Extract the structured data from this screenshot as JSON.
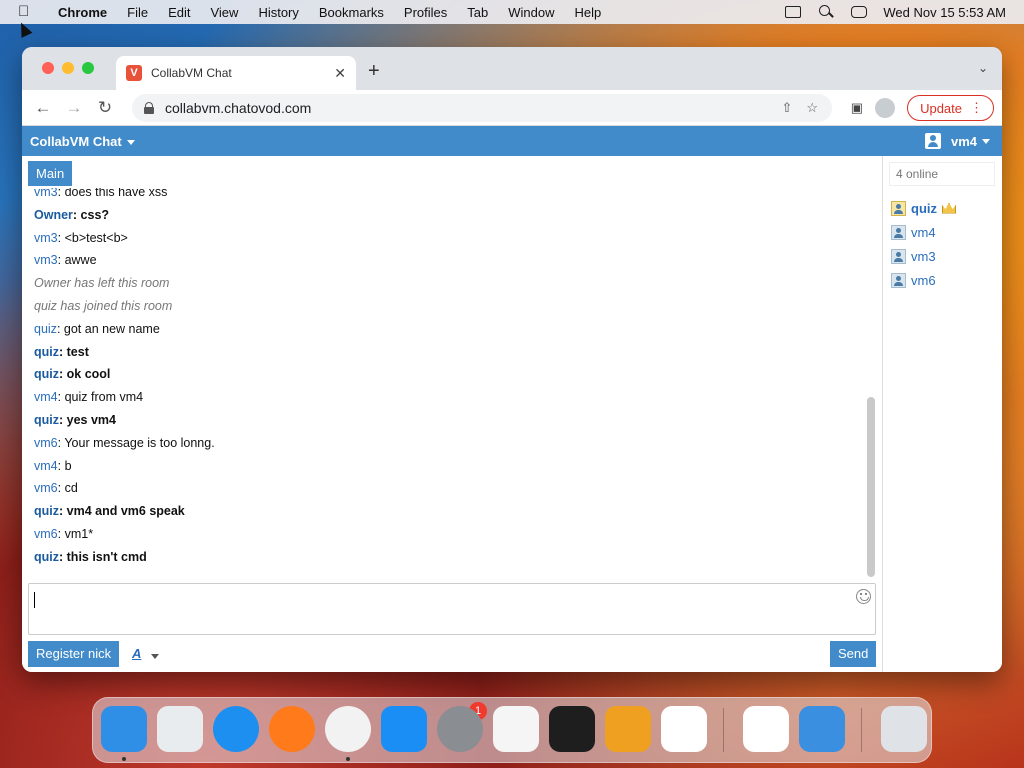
{
  "menubar": {
    "app_name": "Chrome",
    "items": [
      "File",
      "Edit",
      "View",
      "History",
      "Bookmarks",
      "Profiles",
      "Tab",
      "Window",
      "Help"
    ],
    "clock": "Wed Nov 15  5:53 AM"
  },
  "browser": {
    "tab_title": "CollabVM Chat",
    "url": "collabvm.chatovod.com",
    "update_label": "Update"
  },
  "site": {
    "brand": "CollabVM Chat",
    "current_user": "vm4",
    "room_tab": "Main",
    "messages": [
      {
        "nick": "vm3",
        "sep": ": ",
        "text": "does this have xss",
        "style": "normal"
      },
      {
        "nick": "Owner",
        "sep": ": ",
        "text": "css?",
        "style": "bold"
      },
      {
        "nick": "vm3",
        "sep": ": ",
        "text": "<b>test<b>",
        "style": "normal"
      },
      {
        "nick": "vm3",
        "sep": ": ",
        "text": "awwe",
        "style": "normal"
      },
      {
        "nick": "",
        "sep": "",
        "text": "Owner has left this room",
        "style": "system"
      },
      {
        "nick": "",
        "sep": "",
        "text": "quiz has joined this room",
        "style": "system"
      },
      {
        "nick": "quiz",
        "sep": ": ",
        "text": "got an new name",
        "style": "normal"
      },
      {
        "nick": "quiz",
        "sep": ": ",
        "text": "test",
        "style": "bold"
      },
      {
        "nick": "quiz",
        "sep": ": ",
        "text": "ok cool",
        "style": "bold"
      },
      {
        "nick": "vm4",
        "sep": ": ",
        "text": "quiz from vm4",
        "style": "normal"
      },
      {
        "nick": "quiz",
        "sep": ": ",
        "text": "yes vm4",
        "style": "bold"
      },
      {
        "nick": "vm6",
        "sep": ": ",
        "text": "Your message is too lonng.",
        "style": "normal"
      },
      {
        "nick": "vm4",
        "sep": ": ",
        "text": "b",
        "style": "normal"
      },
      {
        "nick": "vm6",
        "sep": ": ",
        "text": "cd",
        "style": "normal"
      },
      {
        "nick": "quiz",
        "sep": ": ",
        "text": "vm4 and vm6 speak",
        "style": "bold"
      },
      {
        "nick": "vm6",
        "sep": ": ",
        "text": "vm1*",
        "style": "normal"
      },
      {
        "nick": "quiz",
        "sep": ": ",
        "text": "this isn't cmd",
        "style": "bold"
      }
    ],
    "register_label": "Register nick",
    "font_label": "A",
    "send_label": "Send",
    "online_count": "4 online",
    "users": [
      {
        "name": "quiz",
        "admin": true
      },
      {
        "name": "vm4",
        "admin": false
      },
      {
        "name": "vm3",
        "admin": false
      },
      {
        "name": "vm6",
        "admin": false
      }
    ]
  },
  "dock": {
    "apps": [
      "finder",
      "launchpad",
      "safari",
      "firefox",
      "chrome",
      "app-store",
      "system-settings",
      "textedit",
      "terminal",
      "garageband",
      "vscode",
      "visual-studio",
      "weather",
      "trash"
    ],
    "settings_badge": "1",
    "colors": {
      "finder": "#2f8fe6",
      "launchpad": "#e9ecef",
      "safari": "#1d8ff0",
      "firefox": "#ff7a1a",
      "chrome": "#f2f2f2",
      "app-store": "#1b8ef5",
      "system-settings": "#8a8d92",
      "textedit": "#f5f5f5",
      "terminal": "#1e1e1e",
      "garageband": "#f0a020",
      "vscode": "#ffffff",
      "visual-studio": "#ffffff",
      "weather": "#3a8fe0",
      "trash": "#dfe3e8"
    }
  },
  "colors": {
    "navbar": "#428bca",
    "nick": "#2a6ebb",
    "update": "#d93025"
  }
}
